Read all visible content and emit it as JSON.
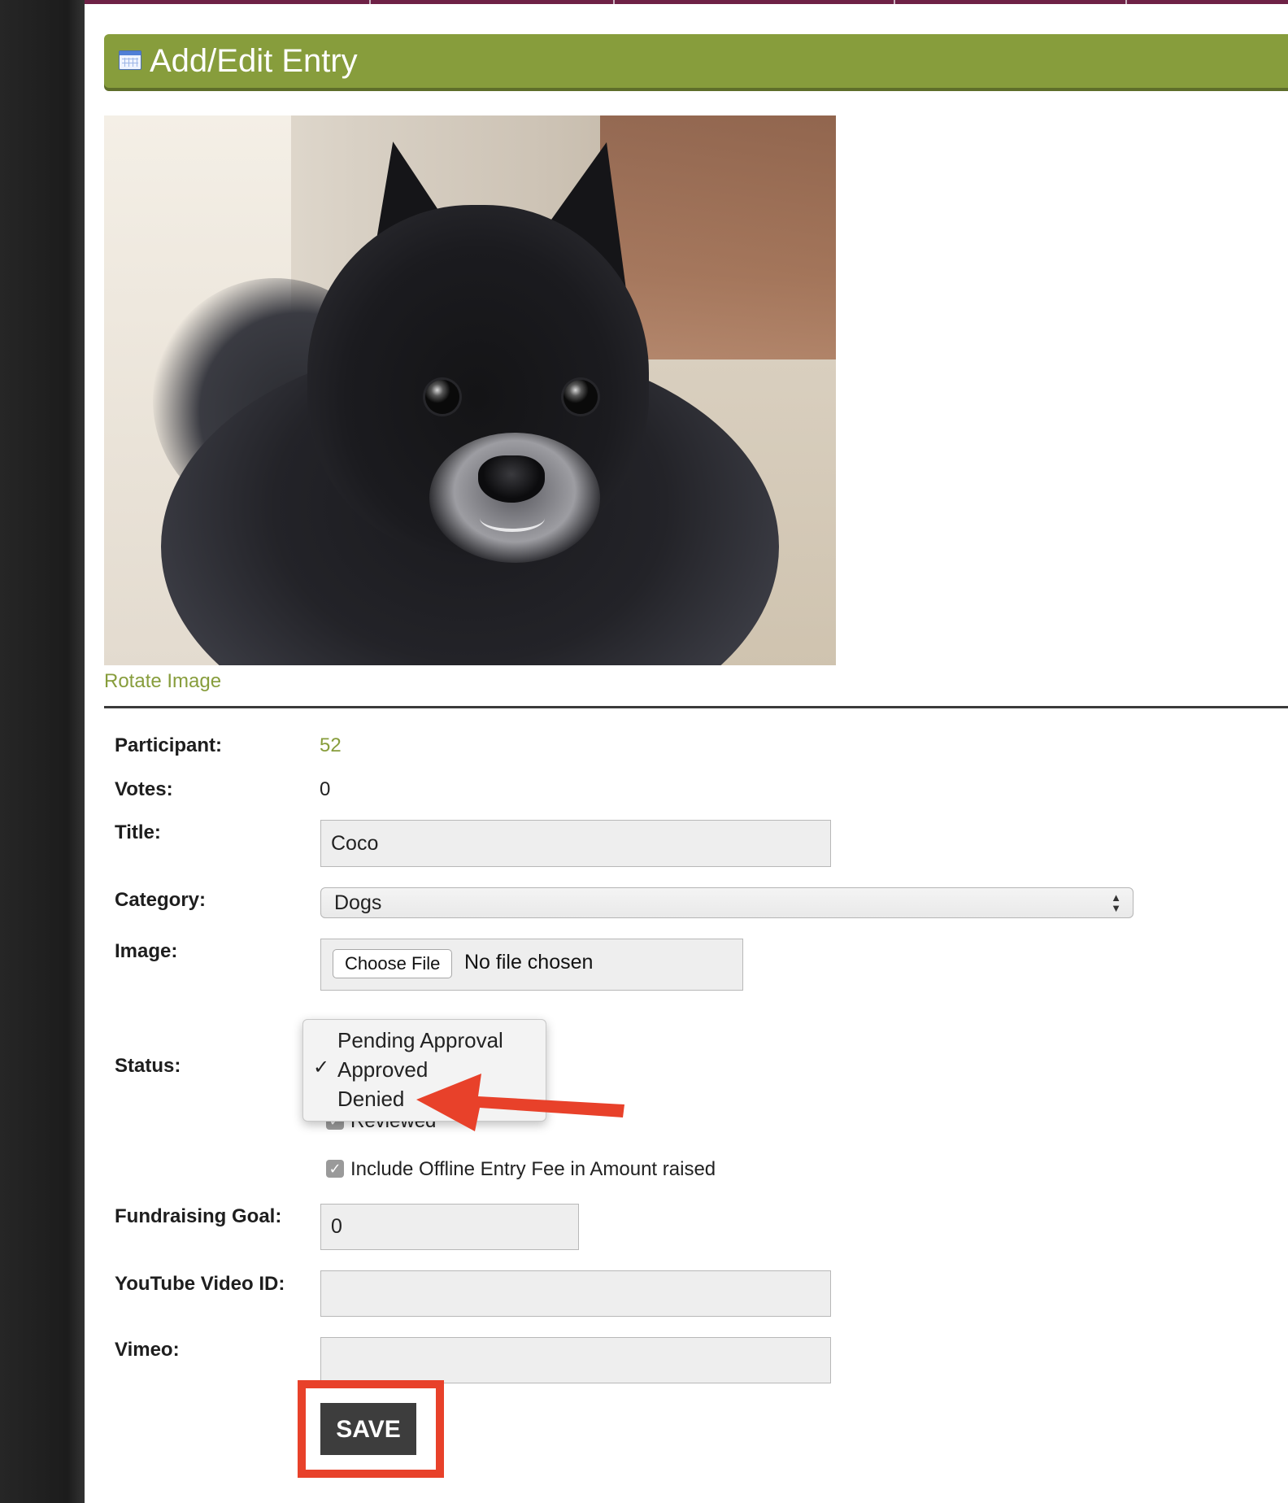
{
  "header": {
    "title": "Add/Edit Entry",
    "icon": "calendar-icon"
  },
  "image_section": {
    "rotate_label": "Rotate Image"
  },
  "form": {
    "participant": {
      "label": "Participant:",
      "value": "52"
    },
    "votes": {
      "label": "Votes:",
      "value": "0"
    },
    "title": {
      "label": "Title:",
      "value": "Coco"
    },
    "category": {
      "label": "Category:",
      "value": "Dogs"
    },
    "image": {
      "label": "Image:",
      "button_label": "Choose File",
      "status": "No file chosen"
    },
    "status": {
      "label": "Status:",
      "options": [
        "Pending Approval",
        "Approved",
        "Denied"
      ],
      "selected": "Approved"
    },
    "reviewed": {
      "label": "Reviewed",
      "checked": true
    },
    "offline_fee": {
      "label": "Include Offline Entry Fee in Amount raised",
      "checked": true
    },
    "fundraising_goal": {
      "label": "Fundraising Goal:",
      "value": "0"
    },
    "youtube": {
      "label": "YouTube Video ID:",
      "value": ""
    },
    "vimeo": {
      "label": "Vimeo:",
      "value": ""
    },
    "save_label": "SAVE"
  },
  "colors": {
    "accent": "#879d3c",
    "top_strip": "#6e2146",
    "annotation_red": "#e8412a",
    "save_button": "#3d3d3d"
  }
}
